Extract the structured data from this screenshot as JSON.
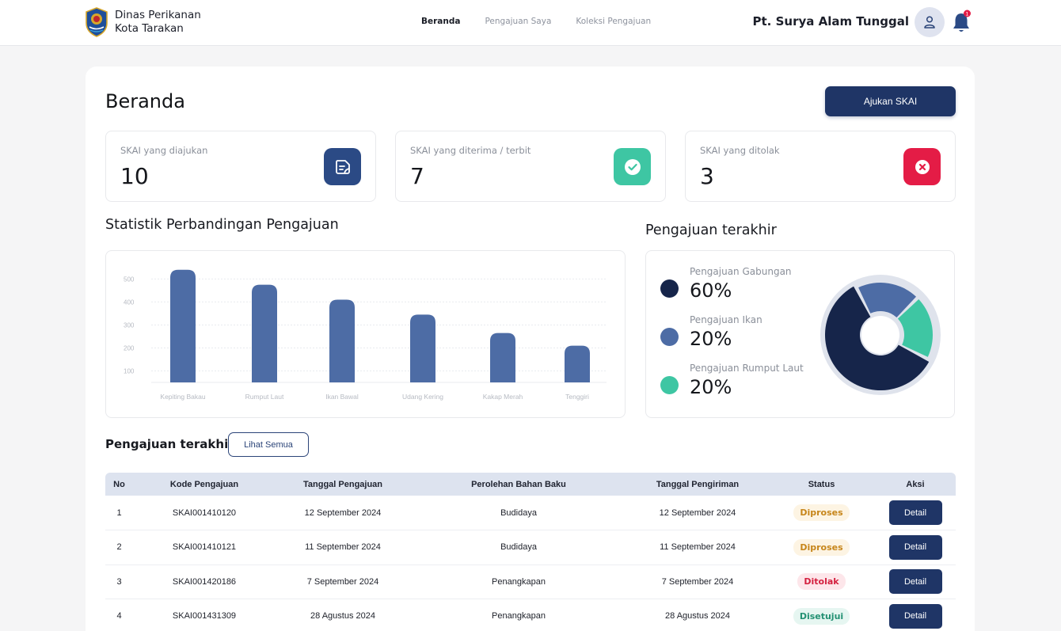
{
  "header": {
    "brand_line1": "Dinas Perikanan",
    "brand_line2": "Kota Tarakan",
    "nav": [
      "Beranda",
      "Pengajuan Saya",
      "Koleksi Pengajuan"
    ],
    "active_nav": "Beranda",
    "company": "Pt. Surya Alam Tunggal",
    "notification_count": "1"
  },
  "page": {
    "title": "Beranda",
    "submit_button": "Ajukan SKAI"
  },
  "stats": [
    {
      "label": "SKAI yang diajukan",
      "value": "10",
      "icon": "document-icon",
      "color": "#2b4a85"
    },
    {
      "label": "SKAI yang diterima / terbit",
      "value": "7",
      "icon": "check-circle-icon",
      "color": "#3ec6a3"
    },
    {
      "label": "SKAI yang ditolak",
      "value": "3",
      "icon": "x-circle-icon",
      "color": "#e41c46"
    }
  ],
  "chart_section_title": "Statistik Perbandingan Pengajuan",
  "chart_data": {
    "type": "bar",
    "categories": [
      "Kepiting Bakau",
      "Rumput Laut",
      "Ikan Bawal",
      "Udang Kering",
      "Kakap Merah",
      "Tenggiri"
    ],
    "values": [
      540,
      475,
      410,
      345,
      265,
      210
    ],
    "yticks": [
      100,
      200,
      300,
      400,
      500
    ],
    "ylim": [
      50,
      560
    ],
    "grid": true,
    "color": "#4d6ca5"
  },
  "donut_section_title": "Pengajuan terakhir",
  "donut": [
    {
      "label": "Pengajuan Gabungan",
      "pct": "60%",
      "value": 60,
      "color": "#16254a"
    },
    {
      "label": "Pengajuan Ikan",
      "pct": "20%",
      "value": 20,
      "color": "#4d6ca5"
    },
    {
      "label": "Pengajuan Rumput Laut",
      "pct": "20%",
      "value": 20,
      "color": "#3ec6a3"
    }
  ],
  "recent": {
    "title": "Pengajuan terakhir",
    "view_all": "Lihat Semua",
    "columns": [
      "No",
      "Kode Pengajuan",
      "Tanggal Pengajuan",
      "Perolehan Bahan Baku",
      "Tanggal Pengiriman",
      "Status",
      "Aksi"
    ],
    "rows": [
      {
        "no": "1",
        "code": "SKAI001410120",
        "date": "12 September 2024",
        "source": "Budidaya",
        "ship": "12 September 2024",
        "status": "Diproses",
        "action": "Detail"
      },
      {
        "no": "2",
        "code": "SKAI001410121",
        "date": "11 September 2024",
        "source": "Budidaya",
        "ship": "11 September 2024",
        "status": "Diproses",
        "action": "Detail"
      },
      {
        "no": "3",
        "code": "SKAI001420186",
        "date": "7 September 2024",
        "source": "Penangkapan",
        "ship": "7 September 2024",
        "status": "Ditolak",
        "action": "Detail"
      },
      {
        "no": "4",
        "code": "SKAI001431309",
        "date": "28 Agustus 2024",
        "source": "Penangkapan",
        "ship": "28 Agustus 2024",
        "status": "Disetujui",
        "action": "Detail"
      }
    ],
    "status_colors": {
      "Diproses": {
        "bg": "#fdf4e3",
        "fg": "#c7861b"
      },
      "Ditolak": {
        "bg": "#fde6ea",
        "fg": "#d4203f"
      },
      "Disetujui": {
        "bg": "#e6f6f1",
        "fg": "#239173"
      }
    }
  }
}
